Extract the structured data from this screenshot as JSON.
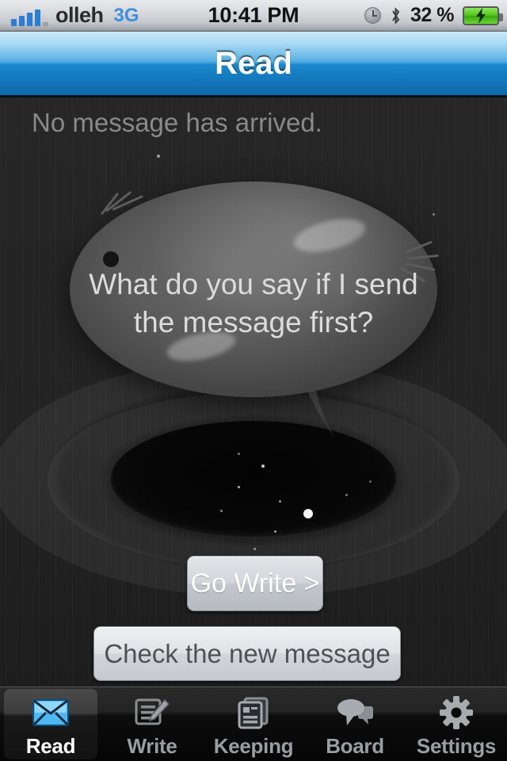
{
  "status_bar": {
    "signal_icon": "signal-bars-icon",
    "carrier": "olleh",
    "network_mode": "3G",
    "time": "10:41 PM",
    "alarm_icon": "alarm-clock-icon",
    "bluetooth_icon": "bluetooth-icon",
    "battery_percent": "32 %",
    "battery_icon": "battery-charging-icon",
    "battery_color": "#4fc41c"
  },
  "nav_bar": {
    "title": "Read",
    "accent_color": "#1a87cd"
  },
  "content": {
    "empty_state_text": "No message has arrived.",
    "bubble_line_1": "What do you say if I send",
    "bubble_line_2": "the message first?",
    "illustration_name": "creature-speech-bubble",
    "background_color": "#232323"
  },
  "buttons": {
    "go_write": "Go Write >",
    "check_new_message": "Check the new message"
  },
  "tab_bar": {
    "active_index": 0,
    "items": [
      {
        "label": "Read",
        "icon": "envelope-icon"
      },
      {
        "label": "Write",
        "icon": "document-pencil-icon"
      },
      {
        "label": "Keeping",
        "icon": "stacked-documents-icon"
      },
      {
        "label": "Board",
        "icon": "speech-bubbles-icon"
      },
      {
        "label": "Settings",
        "icon": "gear-icon"
      }
    ]
  }
}
